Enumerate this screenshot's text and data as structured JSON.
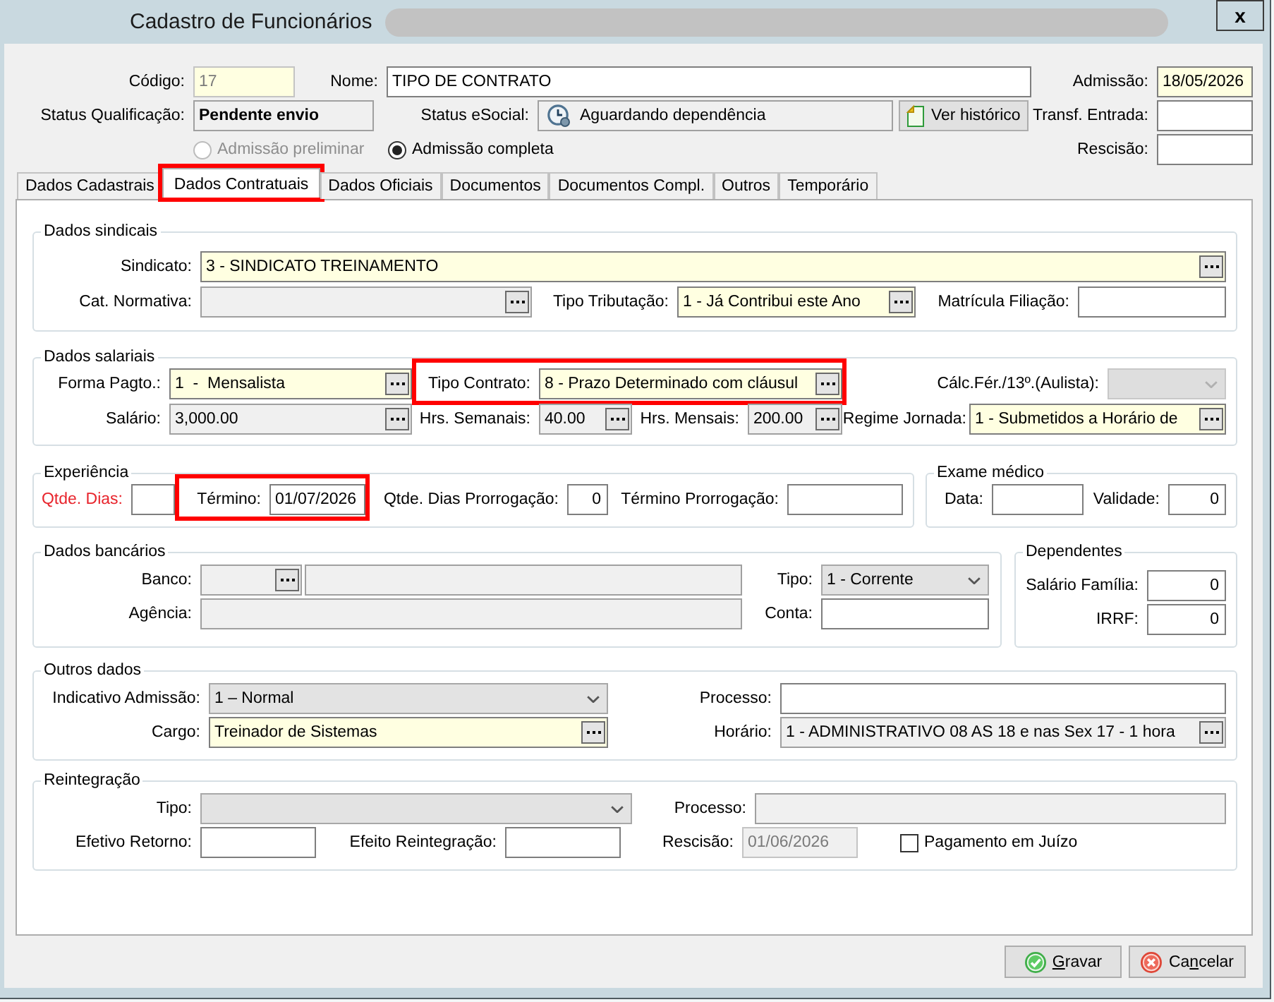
{
  "window": {
    "title": "Cadastro de Funcionários",
    "close_button": "x"
  },
  "header": {
    "rows": [
      {
        "items": [
          {
            "kind": "text",
            "label": "Código:",
            "value": "17",
            "required": true,
            "readonly": false,
            "disabled": true
          },
          {
            "kind": "text",
            "label": "Nome:",
            "value": "TIPO DE CONTRATO",
            "required": false,
            "readonly": false,
            "disabled": false
          },
          {
            "kind": "text",
            "label": "Admissão:",
            "value": "18/05/2026",
            "required": true,
            "readonly": false,
            "disabled": false
          }
        ]
      },
      {
        "items": [
          {
            "kind": "status",
            "label": "Status Qualificação:",
            "value": "Pendente envio",
            "required": false,
            "readonly": true,
            "disabled": false
          },
          {
            "kind": "icon_text",
            "label": "Status eSocial:",
            "value": "Aguardando dependência",
            "required": false,
            "readonly": true,
            "disabled": false
          },
          {
            "kind": "button",
            "label": "Ver histórico"
          },
          {
            "kind": "text",
            "label": "Transf. Entrada:",
            "required": false,
            "readonly": false,
            "disabled": false
          }
        ]
      },
      {
        "radios": [
          {
            "label": "Admissão preliminar",
            "selected": false,
            "disabled": true
          },
          {
            "label": "Admissão completa",
            "selected": true,
            "disabled": false
          }
        ],
        "items": [
          {
            "kind": "text",
            "label": "Rescisão:",
            "required": false,
            "readonly": false,
            "disabled": false
          }
        ]
      }
    ]
  },
  "tabs": [
    {
      "label": "Dados Cadastrais",
      "selected": false,
      "highlighted": false
    },
    {
      "label": "Dados Contratuais",
      "selected": true,
      "highlighted": true
    },
    {
      "label": "Dados Oficiais",
      "selected": false,
      "highlighted": false
    },
    {
      "label": "Documentos",
      "selected": false,
      "highlighted": false
    },
    {
      "label": "Documentos Compl.",
      "selected": false,
      "highlighted": false
    },
    {
      "label": "Outros",
      "selected": false,
      "highlighted": false
    },
    {
      "label": "Temporário",
      "selected": false,
      "highlighted": false
    }
  ],
  "panel": {
    "groups": [
      {
        "title": "Dados sindicais",
        "rows": [
          {
            "items": [
              {
                "kind": "lookup",
                "label": "Sindicato:",
                "value": "3 - SINDICATO TREINAMENTO",
                "required": true,
                "readonly": false,
                "disabled": false,
                "error": false,
                "highlighted": false
              }
            ]
          },
          {
            "items": [
              {
                "kind": "lookup",
                "label": "Cat. Normativa:",
                "required": false,
                "readonly": true,
                "disabled": false,
                "error": false,
                "highlighted": false
              },
              {
                "kind": "lookup",
                "label": "Tipo Tributação:",
                "value": "1 - Já Contribui este Ano",
                "required": true,
                "readonly": false,
                "disabled": false,
                "error": false,
                "highlighted": false
              },
              {
                "kind": "text",
                "label": "Matrícula Filiação:",
                "required": false,
                "readonly": false,
                "disabled": false,
                "error": false,
                "highlighted": false
              }
            ]
          }
        ]
      },
      {
        "title": "Dados salariais",
        "rows": [
          {
            "items": [
              {
                "kind": "lookup",
                "label": "Forma Pagto.:",
                "value": "1  -  Mensalista",
                "required": true,
                "readonly": false,
                "disabled": false,
                "error": false,
                "highlighted": false
              },
              {
                "kind": "lookup",
                "label": "Tipo Contrato:",
                "value": "8 - Prazo Determinado com cláusul",
                "required": true,
                "readonly": false,
                "disabled": false,
                "error": false,
                "highlighted": true
              },
              {
                "kind": "select",
                "label": "Cálc.Fér./13º.(Aulista):",
                "required": false,
                "readonly": false,
                "disabled": true,
                "error": false,
                "highlighted": false
              }
            ]
          },
          {
            "items": [
              {
                "kind": "lookup",
                "label": "Salário:",
                "value": "3,000.00",
                "required": false,
                "readonly": true,
                "disabled": false,
                "error": false,
                "highlighted": false
              },
              {
                "kind": "lookup",
                "label": "Hrs. Semanais:",
                "value": "40.00",
                "required": false,
                "readonly": true,
                "disabled": false,
                "error": false,
                "highlighted": false
              },
              {
                "kind": "lookup",
                "label": "Hrs. Mensais:",
                "value": "200.00",
                "required": false,
                "readonly": true,
                "disabled": false,
                "error": false,
                "highlighted": false
              },
              {
                "kind": "lookup",
                "label": "Regime Jornada:",
                "value": "1 - Submetidos a Horário de",
                "required": true,
                "readonly": false,
                "disabled": false,
                "error": false,
                "highlighted": false
              }
            ]
          }
        ]
      },
      {
        "title": "Experiência",
        "rows": [
          {
            "items": [
              {
                "kind": "text",
                "label": "Qtde. Dias:",
                "required": false,
                "readonly": false,
                "disabled": false,
                "error": true,
                "highlighted": false
              },
              {
                "kind": "text",
                "label": "Término:",
                "value": "01/07/2026",
                "required": false,
                "readonly": false,
                "disabled": false,
                "error": false,
                "highlighted": true
              },
              {
                "kind": "number",
                "label": "Qtde. Dias Prorrogação:",
                "value": "0",
                "required": false,
                "readonly": false,
                "disabled": false,
                "error": false,
                "highlighted": false
              },
              {
                "kind": "text",
                "label": "Término Prorrogação:",
                "required": false,
                "readonly": false,
                "disabled": false,
                "error": false,
                "highlighted": false
              }
            ]
          }
        ]
      },
      {
        "title": "Exame médico",
        "rows": [
          {
            "items": [
              {
                "kind": "text",
                "label": "Data:",
                "required": false,
                "readonly": false,
                "disabled": false,
                "error": false,
                "highlighted": false
              },
              {
                "kind": "number",
                "label": "Validade:",
                "value": "0",
                "required": false,
                "readonly": false,
                "disabled": false,
                "error": false,
                "highlighted": false
              }
            ]
          }
        ]
      },
      {
        "title": "Dados bancários",
        "rows": [
          {
            "items": [
              {
                "kind": "lookup",
                "label": "Banco:",
                "required": false,
                "readonly": true,
                "disabled": false,
                "error": false,
                "highlighted": false
              },
              {
                "kind": "text",
                "required": false,
                "readonly": true,
                "disabled": false,
                "highlighted": false
              },
              {
                "kind": "select",
                "label": "Tipo:",
                "value": "1 - Corrente",
                "required": false,
                "readonly": false,
                "disabled": false,
                "error": false,
                "highlighted": false
              }
            ]
          },
          {
            "items": [
              {
                "kind": "text",
                "label": "Agência:",
                "required": false,
                "readonly": true,
                "disabled": false,
                "error": false,
                "highlighted": false
              },
              {
                "kind": "text",
                "label": "Conta:",
                "required": false,
                "readonly": false,
                "disabled": false,
                "error": false,
                "highlighted": false
              }
            ]
          }
        ]
      },
      {
        "title": "Dependentes",
        "rows": [
          {
            "items": [
              {
                "kind": "number",
                "label": "Salário Família:",
                "value": "0",
                "required": false,
                "readonly": false,
                "disabled": false,
                "error": false,
                "highlighted": false
              }
            ]
          },
          {
            "items": [
              {
                "kind": "number",
                "label": "IRRF:",
                "value": "0",
                "required": false,
                "readonly": false,
                "disabled": false,
                "error": false,
                "highlighted": false
              }
            ]
          }
        ]
      },
      {
        "title": "Outros dados",
        "rows": [
          {
            "items": [
              {
                "kind": "select",
                "label": "Indicativo Admissão:",
                "value": "1 – Normal",
                "required": false,
                "readonly": false,
                "disabled": false,
                "error": false,
                "highlighted": false
              },
              {
                "kind": "text",
                "label": "Processo:",
                "required": false,
                "readonly": false,
                "disabled": false,
                "error": false,
                "highlighted": false
              }
            ]
          },
          {
            "items": [
              {
                "kind": "lookup",
                "label": "Cargo:",
                "value": "Treinador de Sistemas",
                "required": true,
                "readonly": false,
                "disabled": false,
                "error": false,
                "highlighted": false
              },
              {
                "kind": "lookup",
                "label": "Horário:",
                "value": "1 - ADMINISTRATIVO 08 AS 18 e nas Sex 17 - 1 hora",
                "required": false,
                "readonly": true,
                "disabled": false,
                "error": false,
                "highlighted": false
              }
            ]
          }
        ]
      },
      {
        "title": "Reintegração",
        "rows": [
          {
            "items": [
              {
                "kind": "select",
                "label": "Tipo:",
                "required": false,
                "readonly": false,
                "disabled": false,
                "error": false,
                "highlighted": false
              },
              {
                "kind": "text",
                "label": "Processo:",
                "required": false,
                "readonly": true,
                "disabled": false,
                "error": false,
                "highlighted": false
              }
            ]
          },
          {
            "items": [
              {
                "kind": "text",
                "label": "Efetivo Retorno:",
                "required": false,
                "readonly": false,
                "disabled": false,
                "error": false,
                "highlighted": false
              },
              {
                "kind": "text",
                "label": "Efeito Reintegração:",
                "required": false,
                "readonly": false,
                "disabled": false,
                "error": false,
                "highlighted": false
              },
              {
                "kind": "text",
                "label": "Rescisão:",
                "value": "01/06/2026",
                "required": false,
                "readonly": true,
                "disabled": true,
                "error": false,
                "highlighted": false
              }
            ],
            "checkbox": {
              "label": "Pagamento em Juízo",
              "checked": false
            }
          }
        ]
      }
    ]
  },
  "buttons": [
    {
      "kind": "confirm",
      "label_parts": [
        {
          "text": "G",
          "underlined": true
        },
        {
          "text": "ravar",
          "underlined": false
        }
      ]
    },
    {
      "kind": "cancel",
      "label_parts": [
        {
          "text": "Ca",
          "underlined": false
        },
        {
          "text": "n",
          "underlined": true
        },
        {
          "text": "celar",
          "underlined": false
        }
      ]
    }
  ]
}
